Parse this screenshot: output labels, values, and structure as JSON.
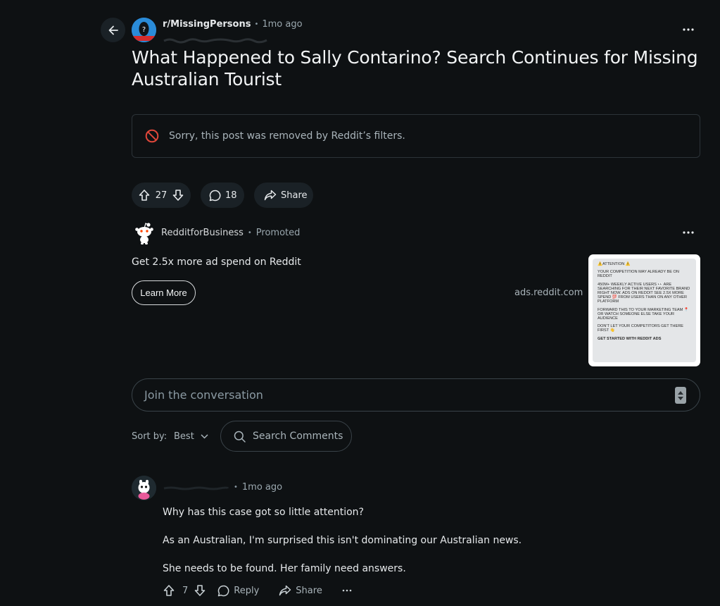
{
  "post": {
    "subreddit": "r/MissingPersons",
    "time": "1mo ago",
    "title": "What Happened to Sally Contarino? Search Continues for Missing Australian Tourist",
    "removed_notice": "Sorry, this post was removed by Reddit’s filters.",
    "votes": "27",
    "comments": "18",
    "share_label": "Share"
  },
  "ad": {
    "advertiser": "RedditforBusiness",
    "promoted": "Promoted",
    "headline": "Get 2.5x more ad spend on Reddit",
    "cta": "Learn More",
    "domain": "ads.reddit.com",
    "creative": {
      "line1": "⚠️ATTENTION ⚠️",
      "line2": "YOUR COMPETITION MAY ALREADY BE ON REDDIT",
      "line3": "450M+ WEEKLY ACTIVE USERS 👀 ARE SEARCHING FOR THEIR NEXT FAVORITE BRAND RIGHT NOW. ADS ON REDDIT SEE 2.5X MORE SPEND 💯 FROM USERS THAN ON ANY OTHER PLATFORM",
      "line4": "FORWARD THIS TO YOUR MARKETING TEAM 📍 OR WATCH SOMEONE ELSE TAKE YOUR AUDIENCE",
      "line5": "DON'T LET YOUR COMPETITORS GET THERE FIRST 👋",
      "line6": "GET STARTED WITH REDDIT ADS"
    }
  },
  "composer": {
    "placeholder": "Join the conversation"
  },
  "sort": {
    "label": "Sort by:",
    "value": "Best",
    "search_placeholder": "Search Comments"
  },
  "comment": {
    "time": "1mo ago",
    "paragraphs": [
      "Why has this case got so little attention?",
      "As an Australian, I'm surprised this isn't dominating our Australian news.",
      "She needs to be found. Her family need answers."
    ],
    "votes": "7",
    "reply_label": "Reply",
    "share_label": "Share"
  },
  "colors": {
    "background": "#0e1113",
    "pill": "#1a2126",
    "removed_icon": "#e0473a",
    "subreddit_avatar": "#2a8bd8"
  }
}
